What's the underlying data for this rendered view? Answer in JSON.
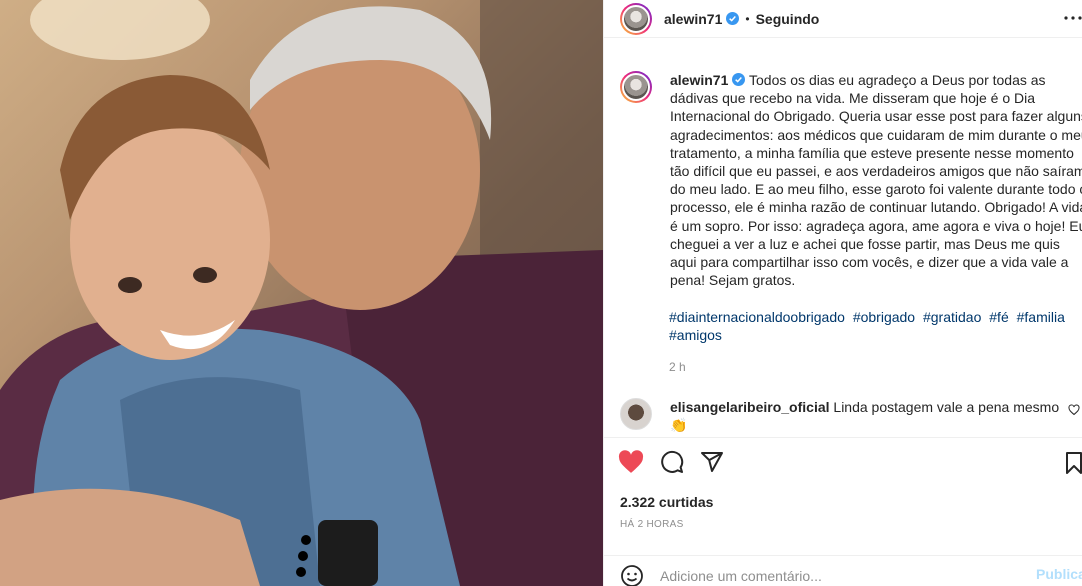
{
  "colors": {
    "link": "#00376b",
    "like_red": "#ed4956",
    "publish_disabled": "#b2dffc",
    "muted": "#8e8e8e"
  },
  "header": {
    "username": "alewin71",
    "separator": "•",
    "follow_status": "Seguindo",
    "more_icon": "more-horizontal-icon"
  },
  "caption": {
    "username": "alewin71",
    "text": "Todos os dias eu agradeço a Deus por todas as dádivas que recebo na vida. Me disseram que hoje é o Dia Internacional do Obrigado. Queria usar esse post para fazer alguns agradecimentos: aos médicos que cuidaram de mim durante o meu tratamento, a minha família que esteve presente nesse momento tão difícil que eu passei, e aos verdadeiros amigos que não saíram do meu lado. E ao meu filho, esse garoto foi valente durante todo o processo, ele é minha razão de continuar lutando. Obrigado! A vida é um sopro. Por isso: agradeça agora, ame agora e viva o hoje! Eu cheguei a ver a luz e achei que fosse partir, mas Deus me quis aqui para compartilhar isso com vocês, e dizer que a vida vale a pena! Sejam gratos.",
    "hashtags": [
      "#diainternacionaldoobrigado",
      "#obrigado",
      "#gratidao",
      "#fé",
      "#familia",
      "#amigos"
    ],
    "time": "2 h"
  },
  "comment": {
    "username": "elisangelaribeiro_oficial",
    "text": "Linda postagem vale a pena mesmo",
    "emoji": "👏"
  },
  "actions": {
    "likes": "2.322 curtidas",
    "time_ago": "HÁ 2 HORAS"
  },
  "comment_input": {
    "placeholder": "Adicione um comentário...",
    "publish_label": "Publicar"
  }
}
